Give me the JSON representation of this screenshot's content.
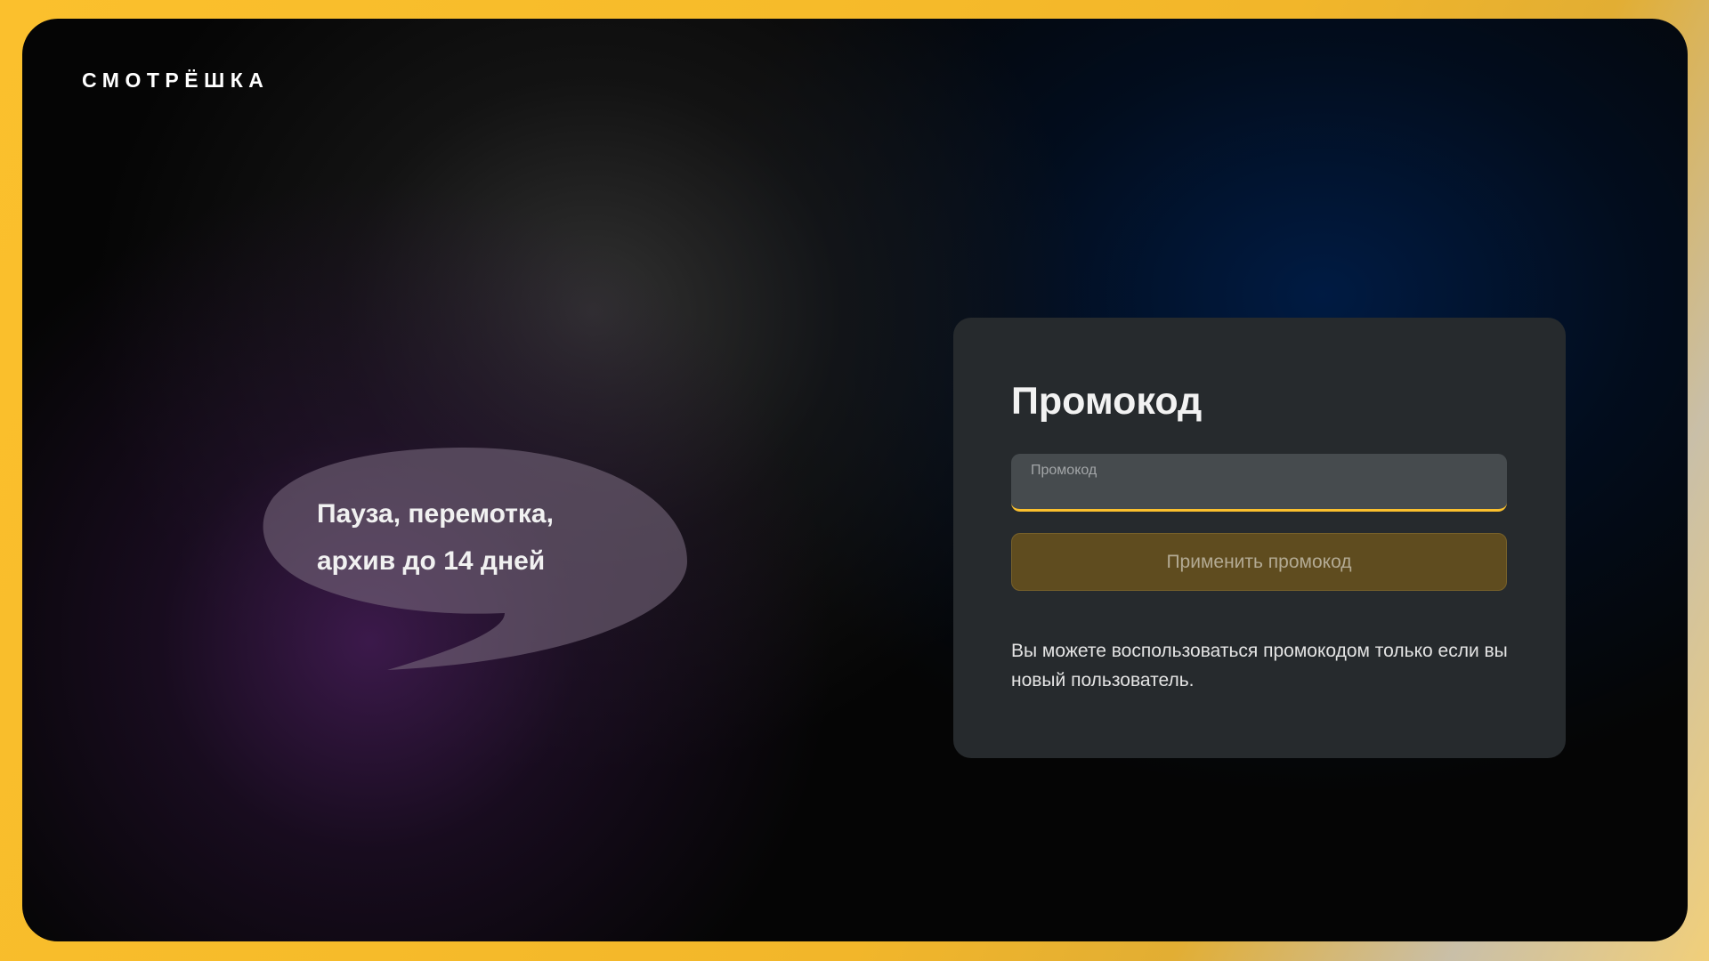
{
  "brand": {
    "logo_text": "СМОТРЁШКА"
  },
  "promo_bubble": {
    "line1": "Пауза, перемотка,",
    "line2": "архив до 14 дней"
  },
  "promo_card": {
    "title": "Промокод",
    "input": {
      "label": "Промокод",
      "value": ""
    },
    "apply_button_label": "Применить промокод",
    "hint": "Вы можете воспользоваться промокодом только если вы новый пользователь."
  },
  "colors": {
    "accent": "#fbc02d",
    "card_bg": "#262a2d",
    "button_bg": "#5f4c1f"
  }
}
